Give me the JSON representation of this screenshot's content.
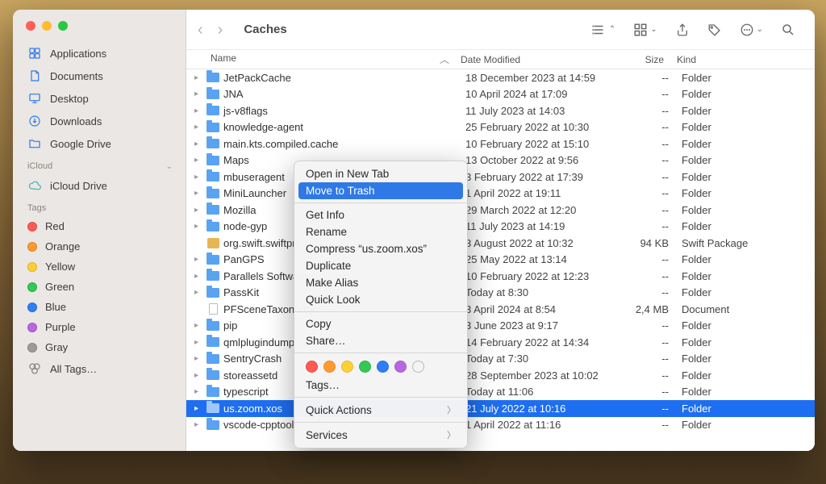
{
  "window": {
    "title": "Caches"
  },
  "sidebar": {
    "favorites": [
      {
        "name": "Applications",
        "icon": "apps"
      },
      {
        "name": "Documents",
        "icon": "doc"
      },
      {
        "name": "Desktop",
        "icon": "desktop"
      },
      {
        "name": "Downloads",
        "icon": "down"
      },
      {
        "name": "Google Drive",
        "icon": "folder"
      }
    ],
    "icloud_header": "iCloud",
    "icloud": [
      {
        "name": "iCloud Drive",
        "icon": "cloud"
      }
    ],
    "tags_header": "Tags",
    "tags": [
      {
        "name": "Red",
        "color": "#ff5b53"
      },
      {
        "name": "Orange",
        "color": "#ff9a2f"
      },
      {
        "name": "Yellow",
        "color": "#ffd036"
      },
      {
        "name": "Green",
        "color": "#33c956"
      },
      {
        "name": "Blue",
        "color": "#2d7ef7"
      },
      {
        "name": "Purple",
        "color": "#b867e2"
      },
      {
        "name": "Gray",
        "color": "#9b9b9b"
      }
    ],
    "all_tags_label": "All Tags…"
  },
  "columns": {
    "name": "Name",
    "date": "Date Modified",
    "size": "Size",
    "kind": "Kind"
  },
  "rows": [
    {
      "name": "JetPackCache",
      "date": "18 December 2023 at 14:59",
      "size": "--",
      "kind": "Folder",
      "type": "folder",
      "expandable": true
    },
    {
      "name": "JNA",
      "date": "10 April 2024 at 17:09",
      "size": "--",
      "kind": "Folder",
      "type": "folder",
      "expandable": true
    },
    {
      "name": "js-v8flags",
      "date": "11 July 2023 at 14:03",
      "size": "--",
      "kind": "Folder",
      "type": "folder",
      "expandable": true
    },
    {
      "name": "knowledge-agent",
      "date": "25 February 2022 at 10:30",
      "size": "--",
      "kind": "Folder",
      "type": "folder",
      "expandable": true
    },
    {
      "name": "main.kts.compiled.cache",
      "date": "10 February 2022 at 15:10",
      "size": "--",
      "kind": "Folder",
      "type": "folder",
      "expandable": true
    },
    {
      "name": "Maps",
      "date": "13 October 2022 at 9:56",
      "size": "--",
      "kind": "Folder",
      "type": "folder",
      "expandable": true
    },
    {
      "name": "mbuseragent",
      "date": "3 February 2022 at 17:39",
      "size": "--",
      "kind": "Folder",
      "type": "folder",
      "expandable": true
    },
    {
      "name": "MiniLauncher",
      "date": "1 April 2022 at 19:11",
      "size": "--",
      "kind": "Folder",
      "type": "folder",
      "expandable": true
    },
    {
      "name": "Mozilla",
      "date": "29 March 2022 at 12:20",
      "size": "--",
      "kind": "Folder",
      "type": "folder",
      "expandable": true
    },
    {
      "name": "node-gyp",
      "date": "11 July 2023 at 14:19",
      "size": "--",
      "kind": "Folder",
      "type": "folder",
      "expandable": true
    },
    {
      "name": "org.swift.swiftpm",
      "date": "3 August 2022 at 10:32",
      "size": "94 KB",
      "kind": "Swift Package",
      "type": "package",
      "expandable": false
    },
    {
      "name": "PanGPS",
      "date": "25 May 2022 at 13:14",
      "size": "--",
      "kind": "Folder",
      "type": "folder",
      "expandable": true
    },
    {
      "name": "Parallels Software",
      "date": "10 February 2022 at 12:23",
      "size": "--",
      "kind": "Folder",
      "type": "folder",
      "expandable": true
    },
    {
      "name": "PassKit",
      "date": "Today at 8:30",
      "size": "--",
      "kind": "Folder",
      "type": "folder",
      "expandable": true
    },
    {
      "name": "PFSceneTaxonomy",
      "date": "3 April 2024 at 8:54",
      "size": "2,4 MB",
      "kind": "Document",
      "type": "document",
      "expandable": false
    },
    {
      "name": "pip",
      "date": "3 June 2023 at 9:17",
      "size": "--",
      "kind": "Folder",
      "type": "folder",
      "expandable": true
    },
    {
      "name": "qmlplugindump",
      "date": "14 February 2022 at 14:34",
      "size": "--",
      "kind": "Folder",
      "type": "folder",
      "expandable": true
    },
    {
      "name": "SentryCrash",
      "date": "Today at 7:30",
      "size": "--",
      "kind": "Folder",
      "type": "folder",
      "expandable": true
    },
    {
      "name": "storeassetd",
      "date": "28 September 2023 at 10:02",
      "size": "--",
      "kind": "Folder",
      "type": "folder",
      "expandable": true
    },
    {
      "name": "typescript",
      "date": "Today at 11:06",
      "size": "--",
      "kind": "Folder",
      "type": "folder",
      "expandable": true
    },
    {
      "name": "us.zoom.xos",
      "date": "21 July 2022 at 10:16",
      "size": "--",
      "kind": "Folder",
      "type": "folder",
      "expandable": true,
      "selected": true
    },
    {
      "name": "vscode-cpptools",
      "date": "1 April 2022 at 11:16",
      "size": "--",
      "kind": "Folder",
      "type": "folder",
      "expandable": true
    }
  ],
  "context_menu": {
    "items_top": [
      {
        "label": "Open in New Tab"
      },
      {
        "label": "Move to Trash",
        "hover": true
      }
    ],
    "items_mid": [
      {
        "label": "Get Info"
      },
      {
        "label": "Rename"
      },
      {
        "label": "Compress “us.zoom.xos”"
      },
      {
        "label": "Duplicate"
      },
      {
        "label": "Make Alias"
      },
      {
        "label": "Quick Look"
      }
    ],
    "items_copy": [
      {
        "label": "Copy"
      },
      {
        "label": "Share…"
      }
    ],
    "tag_colors": [
      "#ff5b53",
      "#ff9a2f",
      "#ffd036",
      "#33c956",
      "#2d7ef7",
      "#b867e2"
    ],
    "tags_label": "Tags…",
    "items_bottom": [
      {
        "label": "Quick Actions",
        "submenu": true
      },
      {
        "label": "Services",
        "submenu": true
      }
    ]
  }
}
